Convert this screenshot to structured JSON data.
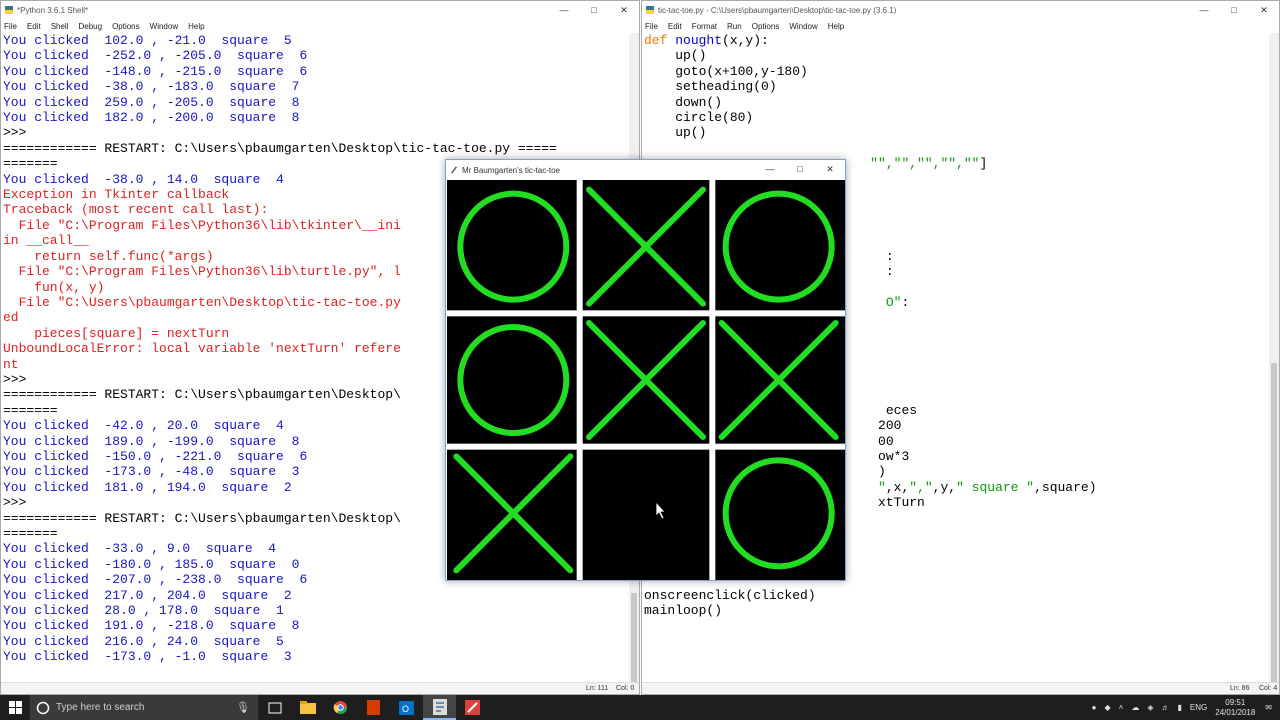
{
  "shell": {
    "title": "*Python 3.6.1 Shell*",
    "menu": [
      "File",
      "Edit",
      "Shell",
      "Debug",
      "Options",
      "Window",
      "Help"
    ],
    "lines": [
      {
        "text": "You clicked  102.0 , -21.0  square  5",
        "cls": "out"
      },
      {
        "text": "You clicked  -252.0 , -205.0  square  6",
        "cls": "out"
      },
      {
        "text": "You clicked  -148.0 , -215.0  square  6",
        "cls": "out"
      },
      {
        "text": "You clicked  -38.0 , -183.0  square  7",
        "cls": "out"
      },
      {
        "text": "You clicked  259.0 , -205.0  square  8",
        "cls": "out"
      },
      {
        "text": "You clicked  182.0 , -200.0  square  8",
        "cls": "out"
      },
      {
        "text": ">>> ",
        "cls": "plain"
      },
      {
        "text": "============ RESTART: C:\\Users\\pbaumgarten\\Desktop\\tic-tac-toe.py =====",
        "cls": "plain"
      },
      {
        "text": "=======",
        "cls": "plain"
      },
      {
        "text": "You clicked  -38.0 , 14.0  square  4",
        "cls": "out"
      },
      {
        "text": "Exception in Tkinter callback",
        "cls": "err"
      },
      {
        "text": "Traceback (most recent call last):",
        "cls": "err"
      },
      {
        "text": "  File \"C:\\Program Files\\Python36\\lib\\tkinter\\__ini",
        "cls": "err"
      },
      {
        "text": "in __call__",
        "cls": "err"
      },
      {
        "text": "    return self.func(*args)",
        "cls": "err"
      },
      {
        "text": "  File \"C:\\Program Files\\Python36\\lib\\turtle.py\", l",
        "cls": "err"
      },
      {
        "text": "    fun(x, y)",
        "cls": "err"
      },
      {
        "text": "  File \"C:\\Users\\pbaumgarten\\Desktop\\tic-tac-toe.py",
        "cls": "err"
      },
      {
        "text": "ed",
        "cls": "err"
      },
      {
        "text": "    pieces[square] = nextTurn",
        "cls": "err"
      },
      {
        "text": "UnboundLocalError: local variable 'nextTurn' refere",
        "cls": "err"
      },
      {
        "text": "nt",
        "cls": "err"
      },
      {
        "text": ">>> ",
        "cls": "plain"
      },
      {
        "text": "============ RESTART: C:\\Users\\pbaumgarten\\Desktop\\",
        "cls": "plain"
      },
      {
        "text": "=======",
        "cls": "plain"
      },
      {
        "text": "You clicked  -42.0 , 20.0  square  4",
        "cls": "out"
      },
      {
        "text": "You clicked  189.0 , -199.0  square  8",
        "cls": "out"
      },
      {
        "text": "You clicked  -150.0 , -221.0  square  6",
        "cls": "out"
      },
      {
        "text": "You clicked  -173.0 , -48.0  square  3",
        "cls": "out"
      },
      {
        "text": "You clicked  181.0 , 194.0  square  2",
        "cls": "out"
      },
      {
        "text": ">>> ",
        "cls": "plain"
      },
      {
        "text": "============ RESTART: C:\\Users\\pbaumgarten\\Desktop\\",
        "cls": "plain"
      },
      {
        "text": "=======",
        "cls": "plain"
      },
      {
        "text": "You clicked  -33.0 , 9.0  square  4",
        "cls": "out"
      },
      {
        "text": "You clicked  -180.0 , 185.0  square  0",
        "cls": "out"
      },
      {
        "text": "You clicked  -207.0 , -238.0  square  6",
        "cls": "out"
      },
      {
        "text": "You clicked  217.0 , 204.0  square  2",
        "cls": "out"
      },
      {
        "text": "You clicked  28.0 , 178.0  square  1",
        "cls": "out"
      },
      {
        "text": "You clicked  191.0 , -218.0  square  8",
        "cls": "out"
      },
      {
        "text": "You clicked  216.0 , 24.0  square  5",
        "cls": "out"
      },
      {
        "text": "You clicked  -173.0 , -1.0  square  3",
        "cls": "out"
      }
    ],
    "status_ln": "Ln: 111",
    "status_col": "Col: 0"
  },
  "editor": {
    "title": "tic-tac-toe.py - C:\\Users\\pbaumgarten\\Desktop\\tic-tac-toe.py (3.6.1)",
    "menu": [
      "File",
      "Edit",
      "Format",
      "Run",
      "Options",
      "Window",
      "Help"
    ],
    "status_ln": "Ln: 86",
    "status_col": "Col: 4"
  },
  "turtle_window": {
    "title": "Mr Baumgarten's tic-tac-toe",
    "board": [
      "O",
      "X",
      "O",
      "O",
      "X",
      "X",
      "X",
      "",
      "O"
    ],
    "piece_color": "#22dd22"
  },
  "taskbar": {
    "search_placeholder": "Type here to search",
    "time": "09:51",
    "date": "24/01/2018",
    "lang": "ENG"
  }
}
